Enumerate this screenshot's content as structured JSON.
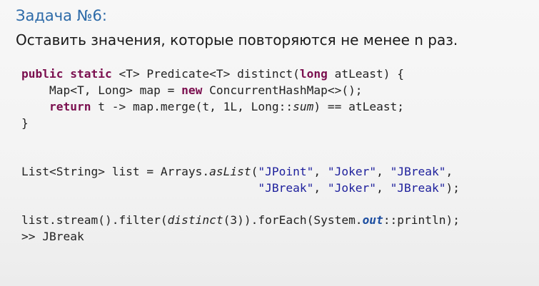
{
  "slide": {
    "title": "Задача №6:",
    "subtitle": "Оставить значения, которые повторяются не менее n раз."
  },
  "code": {
    "block1": {
      "l1": {
        "kw1": "public static",
        "t1": " <T> Predicate<T> distinct(",
        "kw2": "long",
        "t2": " atLeast) {"
      },
      "l2": {
        "t1": "    Map<T, Long> map = ",
        "kw1": "new",
        "t2": " ConcurrentHashMap<>();"
      },
      "l3": {
        "kw1": "    return",
        "t1": " t -> map.merge(t, 1L, Long::",
        "it1": "sum",
        "t2": ") == atLeast;"
      },
      "l4": "}"
    },
    "block2": {
      "l1": {
        "t1": "List<String> list = Arrays.",
        "it1": "asList",
        "t2": "(",
        "s1": "\"JPoint\"",
        "c1": ", ",
        "s2": "\"Joker\"",
        "c2": ", ",
        "s3": "\"JBreak\"",
        "c3": ","
      },
      "l2": {
        "indent": "                                  ",
        "s1": "\"JBreak\"",
        "c1": ", ",
        "s2": "\"Joker\"",
        "c2": ", ",
        "s3": "\"JBreak\"",
        "t1": ");"
      }
    },
    "block3": {
      "l1": {
        "t1": "list.stream().filter(",
        "it1": "distinct",
        "t2": "(3)).forEach(System.",
        "fld1": "out",
        "t3": "::println);"
      },
      "l2": ">> JBreak"
    }
  }
}
